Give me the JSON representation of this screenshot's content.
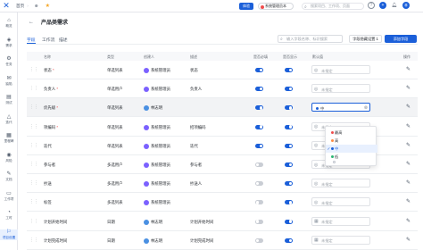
{
  "topbar": {
    "home": "首页",
    "section": "⊕",
    "upgrade": "体验",
    "admin": "系统管理员本",
    "search_placeholder": "搜索项目、工作项、页面"
  },
  "sidebar": [
    {
      "icon": "⌂",
      "label": "概览"
    },
    {
      "icon": "◈",
      "label": "需求"
    },
    {
      "icon": "⚙",
      "label": "任务"
    },
    {
      "icon": "✉",
      "label": "缺陷"
    },
    {
      "icon": "▤",
      "label": "测试"
    },
    {
      "icon": "△",
      "label": "迭代"
    },
    {
      "icon": "▦",
      "label": "里程碑"
    },
    {
      "icon": "◉",
      "label": "风险"
    },
    {
      "icon": "✎",
      "label": "文档"
    },
    {
      "icon": "▭",
      "label": "工作项"
    },
    {
      "icon": "◔",
      "label": "工时"
    },
    {
      "icon": "⚐",
      "label": "项目设置"
    }
  ],
  "page": {
    "title": "产品类需求",
    "tabs": [
      "字段",
      "工作流",
      "描述"
    ],
    "search_placeholder": "输入字段名称、标识搜索",
    "hide_button": "字段隐藏设置 1",
    "add_button": "添加字段"
  },
  "columns": [
    "名称",
    "类型",
    "创建人",
    "描述",
    "是否必填",
    "是否显示",
    "默认值",
    "操作"
  ],
  "rows": [
    {
      "name": "状态",
      "req": true,
      "type": "单选列表",
      "creator": "系统管理员",
      "desc": "状态",
      "avatar_color": "#7b61ff",
      "required": true,
      "shown": true,
      "default": "未指定"
    },
    {
      "name": "负责人",
      "req": true,
      "type": "单选用户",
      "creator": "系统管理员",
      "desc": "负责人",
      "avatar_color": "#7b61ff",
      "required": true,
      "shown": true,
      "default": "未指定"
    },
    {
      "name": "优先级",
      "req": true,
      "type": "单选列表",
      "creator": "林志明",
      "desc": "",
      "avatar_color": "#4a90e2",
      "required": true,
      "shown": true,
      "default": "中"
    },
    {
      "name": "项编码",
      "req": true,
      "type": "单选列表",
      "creator": "系统管理员",
      "desc": "招项编码",
      "avatar_color": "#7b61ff",
      "required": true,
      "shown": true,
      "default": "未指定"
    },
    {
      "name": "迭代",
      "req": false,
      "type": "单选列表",
      "creator": "系统管理员",
      "desc": "迭代",
      "avatar_color": "#7b61ff",
      "required": true,
      "shown": true,
      "default": "未指定"
    },
    {
      "name": "参与者",
      "req": false,
      "type": "多选用户",
      "creator": "系统管理员",
      "desc": "参与者",
      "avatar_color": "#7b61ff",
      "required": false,
      "shown": true,
      "default": "未指定"
    },
    {
      "name": "抄送",
      "req": false,
      "type": "多选用户",
      "creator": "系统管理员",
      "desc": "抄送人",
      "avatar_color": "#7b61ff",
      "required": false,
      "shown": true,
      "default": "未指定"
    },
    {
      "name": "标签",
      "req": false,
      "type": "多选列表",
      "creator": "系统管理员",
      "desc": "",
      "avatar_color": "#7b61ff",
      "required": false,
      "shown": true,
      "default": "未指定"
    },
    {
      "name": "计划开始时间",
      "req": false,
      "type": "日期",
      "creator": "林志明",
      "desc": "计划开始时间",
      "avatar_color": "#4a90e2",
      "required": false,
      "shown": true,
      "default": "未指定"
    },
    {
      "name": "计划完成时间",
      "req": false,
      "type": "日期",
      "creator": "林志明",
      "desc": "计划完成时间",
      "avatar_color": "#4a90e2",
      "required": false,
      "shown": true,
      "default": "未指定"
    }
  ],
  "dropdown": {
    "options": [
      {
        "label": "最高",
        "color": "#f04d4d"
      },
      {
        "label": "高",
        "color": "#ff8c42"
      },
      {
        "label": "中",
        "color": "#1b5fd9"
      },
      {
        "label": "低",
        "color": "#2bb673"
      }
    ],
    "selected_index": 2
  }
}
